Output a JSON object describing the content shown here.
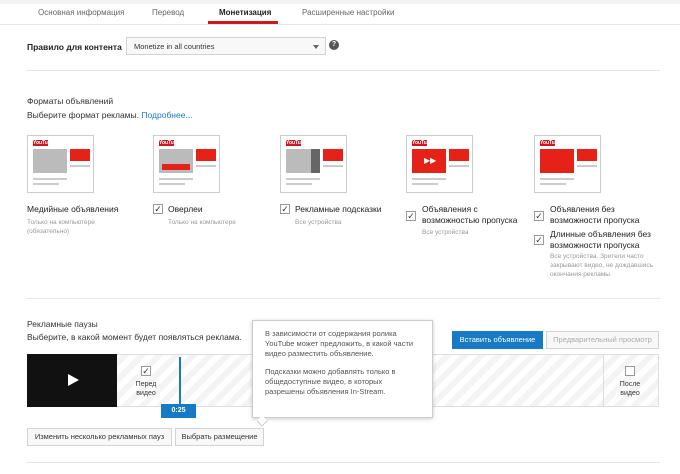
{
  "tabs": [
    "Основная информация",
    "Перевод",
    "Монетизация",
    "Расширенные настройки"
  ],
  "content_rule": {
    "label": "Правило для контента",
    "value": "Monetize in all countries",
    "help": "?"
  },
  "formats": {
    "heading": "Форматы объявлений",
    "choose": "Выберите формат рекламы.",
    "more": "Подробнее...",
    "items": [
      {
        "title": "Медийные объявления",
        "sub": "Только на компьютере (обязательно)",
        "checked": false
      },
      {
        "title": "Оверлеи",
        "sub": "Только на компьютере",
        "checked": true
      },
      {
        "title": "Рекламные подсказки",
        "sub": "Все устройства",
        "checked": true
      },
      {
        "title": "Объявления с возможностью пропуска",
        "sub": "Все устройства",
        "checked": true
      },
      {
        "title": "Объявления без возможности пропуска",
        "sub": "",
        "checked": true
      },
      {
        "title": "Длинные объявления без возможности пропуска",
        "sub": "Все устройства. Зрители часто закрывают видео, не дождавшись окончания рекламы.",
        "checked": true
      }
    ],
    "logo": "YouTube"
  },
  "breaks": {
    "heading": "Рекламные паузы",
    "choose": "Выберите, в какой момент будет появляться реклама.",
    "insert_btn": "Вставить объявление",
    "preview_btn": "Предварительный просмотр",
    "before": "Перед видео",
    "after": "После видео",
    "time": "0:25",
    "change_btn": "Изменить несколько рекламных пауз",
    "select_btn": "Выбрать размещение",
    "check_mark": "✓"
  },
  "tooltip": {
    "p1": "В зависимости от содержания ролика YouTube может предложить, в какой части видео разместить объявление.",
    "p2": "Подсказки можно добавлять только в общедоступные видео, в которых разрешены объявления In-Stream."
  },
  "colors": {
    "accent": "#167ac6",
    "brand_red": "#cc181e"
  }
}
